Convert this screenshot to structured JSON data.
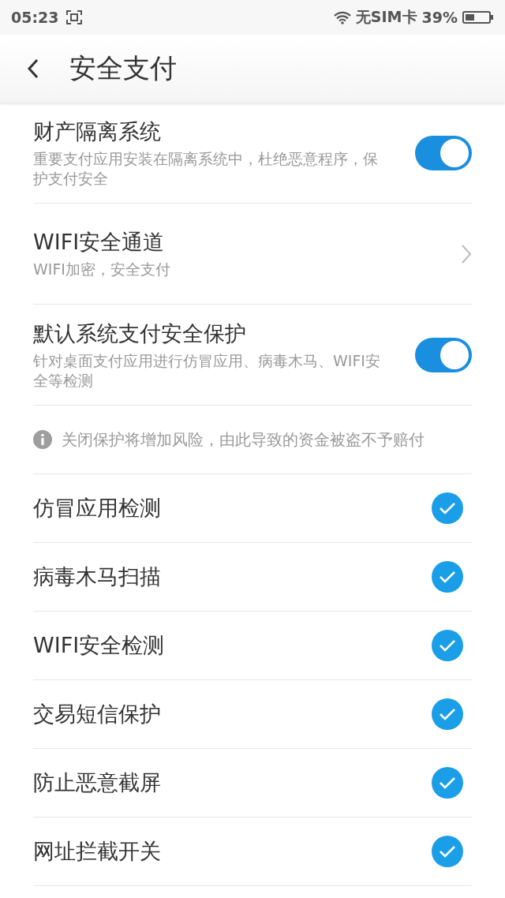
{
  "status_bar": {
    "time": "05:23",
    "carrier": "无SIM卡",
    "battery": "39%"
  },
  "header": {
    "title": "安全支付"
  },
  "items": [
    {
      "kind": "toggle",
      "title": "财产隔离系统",
      "subtitle": "重要支付应用安装在隔离系统中，杜绝恶意程序，保护支付安全",
      "on": true
    },
    {
      "kind": "link",
      "title": "WIFI安全通道",
      "subtitle": "WIFI加密，安全支付"
    },
    {
      "kind": "toggle",
      "title": "默认系统支付安全保护",
      "subtitle": "针对桌面支付应用进行仿冒应用、病毒木马、WIFI安全等检测",
      "on": true
    },
    {
      "kind": "info",
      "title": "关闭保护将增加风险，由此导致的资金被盗不予赔付"
    },
    {
      "kind": "check",
      "title": "仿冒应用检测",
      "checked": true
    },
    {
      "kind": "check",
      "title": "病毒木马扫描",
      "checked": true
    },
    {
      "kind": "check",
      "title": "WIFI安全检测",
      "checked": true
    },
    {
      "kind": "check",
      "title": "交易短信保护",
      "checked": true
    },
    {
      "kind": "check",
      "title": "防止恶意截屏",
      "checked": true
    },
    {
      "kind": "check",
      "title": "网址拦截开关",
      "checked": true
    }
  ]
}
